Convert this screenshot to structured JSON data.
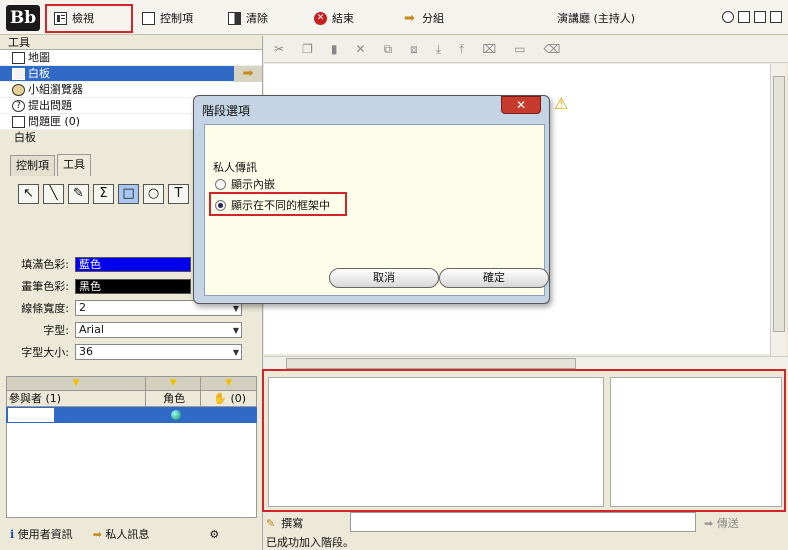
{
  "app": {
    "logo": "Bb"
  },
  "toolbar": {
    "view_label": "檢視",
    "controls_label": "控制項",
    "clear_label": "清除",
    "end_label": "結束",
    "group_label": "分組",
    "presenter": "演講廳 (主持人)"
  },
  "tools": {
    "header": "工具",
    "items": [
      {
        "label": "地圖",
        "icon": "book-icon"
      },
      {
        "label": "白板",
        "icon": "folder-icon"
      },
      {
        "label": "小組瀏覽器",
        "icon": "people-icon"
      },
      {
        "label": "提出問題",
        "icon": "question-icon"
      },
      {
        "label": "問題匣 (0)",
        "icon": "inbox-icon"
      }
    ]
  },
  "whiteboard": {
    "title": "白板",
    "tabs": [
      "控制項",
      "工具"
    ],
    "tool_glyphs": [
      "↖",
      "╲",
      "✎",
      "Σ",
      "□",
      "○",
      "T"
    ],
    "fill_color_label": "填滿色彩:",
    "fill_color_value": "藍色",
    "fill_color_hex": "#0000ee",
    "pen_color_label": "畫筆色彩:",
    "pen_color_value": "黑色",
    "pen_color_hex": "#000000",
    "line_width_label": "線條寬度:",
    "line_width_value": "2",
    "font_label": "字型:",
    "font_value": "Arial",
    "font_size_label": "字型大小:",
    "font_size_value": "36"
  },
  "participants": {
    "name_header": "參與者 (1)",
    "role_header": "角色",
    "hand_header": "(0)"
  },
  "bottom_left": {
    "user_info": "使用者資訊",
    "private_msg": "私人訊息"
  },
  "chat": {
    "compose_label": "撰寫",
    "send_label": "傳送"
  },
  "status": {
    "text": "已成功加入階段。"
  },
  "dialog": {
    "title": "階段選項",
    "group_label": "私人傳訊",
    "option1": "顯示內嵌",
    "option2": "顯示在不同的框架中",
    "selected": 2,
    "cancel": "取消",
    "ok": "確定"
  },
  "colors": {
    "highlight": "#d0262a",
    "selection": "#3169c6"
  }
}
